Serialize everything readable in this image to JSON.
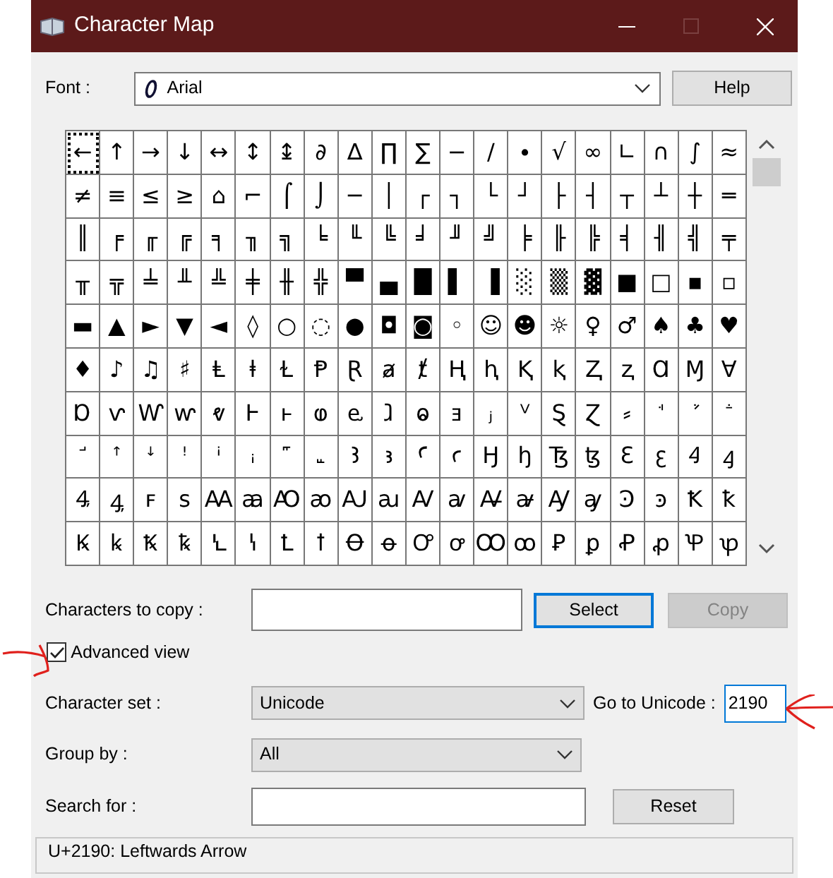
{
  "window": {
    "title": "Character Map",
    "maximize_disabled": true
  },
  "font": {
    "label": "Font :",
    "value": "Arial"
  },
  "help_button": {
    "label": "Help"
  },
  "grid": {
    "rows": [
      {
        "cells": [
          {
            "char": "←",
            "selected": true
          },
          {
            "char": "↑",
            "selected": false
          },
          {
            "char": "→",
            "selected": false
          },
          {
            "char": "↓",
            "selected": false
          },
          {
            "char": "↔",
            "selected": false
          },
          {
            "char": "↕",
            "selected": false
          },
          {
            "char": "↨",
            "selected": false
          },
          {
            "char": "∂",
            "selected": false
          },
          {
            "char": "∆",
            "selected": false
          },
          {
            "char": "∏",
            "selected": false
          },
          {
            "char": "∑",
            "selected": false
          },
          {
            "char": "−",
            "selected": false
          },
          {
            "char": "∕",
            "selected": false
          },
          {
            "char": "∙",
            "selected": false
          },
          {
            "char": "√",
            "selected": false
          },
          {
            "char": "∞",
            "selected": false
          },
          {
            "char": "∟",
            "selected": false
          },
          {
            "char": "∩",
            "selected": false
          },
          {
            "char": "∫",
            "selected": false
          },
          {
            "char": "≈",
            "selected": false
          }
        ]
      },
      {
        "cells": [
          {
            "char": "≠",
            "selected": false
          },
          {
            "char": "≡",
            "selected": false
          },
          {
            "char": "≤",
            "selected": false
          },
          {
            "char": "≥",
            "selected": false
          },
          {
            "char": "⌂",
            "selected": false
          },
          {
            "char": "⌐",
            "selected": false
          },
          {
            "char": "⌠",
            "selected": false
          },
          {
            "char": "⌡",
            "selected": false
          },
          {
            "char": "─",
            "selected": false
          },
          {
            "char": "│",
            "selected": false
          },
          {
            "char": "┌",
            "selected": false
          },
          {
            "char": "┐",
            "selected": false
          },
          {
            "char": "└",
            "selected": false
          },
          {
            "char": "┘",
            "selected": false
          },
          {
            "char": "├",
            "selected": false
          },
          {
            "char": "┤",
            "selected": false
          },
          {
            "char": "┬",
            "selected": false
          },
          {
            "char": "┴",
            "selected": false
          },
          {
            "char": "┼",
            "selected": false
          },
          {
            "char": "═",
            "selected": false
          }
        ]
      },
      {
        "cells": [
          {
            "char": "║",
            "selected": false
          },
          {
            "char": "╒",
            "selected": false
          },
          {
            "char": "╓",
            "selected": false
          },
          {
            "char": "╔",
            "selected": false
          },
          {
            "char": "╕",
            "selected": false
          },
          {
            "char": "╖",
            "selected": false
          },
          {
            "char": "╗",
            "selected": false
          },
          {
            "char": "╘",
            "selected": false
          },
          {
            "char": "╙",
            "selected": false
          },
          {
            "char": "╚",
            "selected": false
          },
          {
            "char": "╛",
            "selected": false
          },
          {
            "char": "╜",
            "selected": false
          },
          {
            "char": "╝",
            "selected": false
          },
          {
            "char": "╞",
            "selected": false
          },
          {
            "char": "╟",
            "selected": false
          },
          {
            "char": "╠",
            "selected": false
          },
          {
            "char": "╡",
            "selected": false
          },
          {
            "char": "╢",
            "selected": false
          },
          {
            "char": "╣",
            "selected": false
          },
          {
            "char": "╤",
            "selected": false
          }
        ]
      },
      {
        "cells": [
          {
            "char": "╥",
            "selected": false
          },
          {
            "char": "╦",
            "selected": false
          },
          {
            "char": "╧",
            "selected": false
          },
          {
            "char": "╨",
            "selected": false
          },
          {
            "char": "╩",
            "selected": false
          },
          {
            "char": "╪",
            "selected": false
          },
          {
            "char": "╫",
            "selected": false
          },
          {
            "char": "╬",
            "selected": false
          },
          {
            "char": "▀",
            "selected": false
          },
          {
            "char": "▄",
            "selected": false
          },
          {
            "char": "█",
            "selected": false
          },
          {
            "char": "▌",
            "selected": false
          },
          {
            "char": "▐",
            "selected": false
          },
          {
            "char": "░",
            "selected": false
          },
          {
            "char": "▒",
            "selected": false
          },
          {
            "char": "▓",
            "selected": false
          },
          {
            "char": "■",
            "selected": false
          },
          {
            "char": "□",
            "selected": false
          },
          {
            "char": "▪",
            "selected": false
          },
          {
            "char": "▫",
            "selected": false
          }
        ]
      },
      {
        "cells": [
          {
            "char": "▬",
            "selected": false
          },
          {
            "char": "▲",
            "selected": false
          },
          {
            "char": "►",
            "selected": false
          },
          {
            "char": "▼",
            "selected": false
          },
          {
            "char": "◄",
            "selected": false
          },
          {
            "char": "◊",
            "selected": false
          },
          {
            "char": "○",
            "selected": false
          },
          {
            "char": "◌",
            "selected": false
          },
          {
            "char": "●",
            "selected": false
          },
          {
            "char": "◘",
            "selected": false
          },
          {
            "char": "◙",
            "selected": false
          },
          {
            "char": "◦",
            "selected": false
          },
          {
            "char": "☺",
            "selected": false
          },
          {
            "char": "☻",
            "selected": false
          },
          {
            "char": "☼",
            "selected": false
          },
          {
            "char": "♀",
            "selected": false
          },
          {
            "char": "♂",
            "selected": false
          },
          {
            "char": "♠",
            "selected": false
          },
          {
            "char": "♣",
            "selected": false
          },
          {
            "char": "♥",
            "selected": false
          }
        ]
      },
      {
        "cells": [
          {
            "char": "♦",
            "selected": false
          },
          {
            "char": "♪",
            "selected": false
          },
          {
            "char": "♫",
            "selected": false
          },
          {
            "char": "♯",
            "selected": false
          },
          {
            "char": "Ⱡ",
            "selected": false
          },
          {
            "char": "ⱡ",
            "selected": false
          },
          {
            "char": "Ɫ",
            "selected": false
          },
          {
            "char": "Ᵽ",
            "selected": false
          },
          {
            "char": "Ɽ",
            "selected": false
          },
          {
            "char": "ⱥ",
            "selected": false
          },
          {
            "char": "ⱦ",
            "selected": false
          },
          {
            "char": "Ⱨ",
            "selected": false
          },
          {
            "char": "ⱨ",
            "selected": false
          },
          {
            "char": "Ⱪ",
            "selected": false
          },
          {
            "char": "ⱪ",
            "selected": false
          },
          {
            "char": "Ⱬ",
            "selected": false
          },
          {
            "char": "ⱬ",
            "selected": false
          },
          {
            "char": "Ɑ",
            "selected": false
          },
          {
            "char": "Ɱ",
            "selected": false
          },
          {
            "char": "Ɐ",
            "selected": false
          }
        ]
      },
      {
        "cells": [
          {
            "char": "Ɒ",
            "selected": false
          },
          {
            "char": "ⱱ",
            "selected": false
          },
          {
            "char": "Ⱳ",
            "selected": false
          },
          {
            "char": "ⱳ",
            "selected": false
          },
          {
            "char": "ⱴ",
            "selected": false
          },
          {
            "char": "Ⱶ",
            "selected": false
          },
          {
            "char": "ⱶ",
            "selected": false
          },
          {
            "char": "ⱷ",
            "selected": false
          },
          {
            "char": "ⱸ",
            "selected": false
          },
          {
            "char": "ⱹ",
            "selected": false
          },
          {
            "char": "ⱺ",
            "selected": false
          },
          {
            "char": "ⱻ",
            "selected": false
          },
          {
            "char": "ⱼ",
            "selected": false
          },
          {
            "char": "ⱽ",
            "selected": false
          },
          {
            "char": "Ȿ",
            "selected": false
          },
          {
            "char": "Ɀ",
            "selected": false
          },
          {
            "char": "⸗",
            "selected": false
          },
          {
            "char": "ꜗ",
            "selected": false
          },
          {
            "char": "ꜘ",
            "selected": false
          },
          {
            "char": "ꜙ",
            "selected": false
          }
        ]
      },
      {
        "cells": [
          {
            "char": "ꜚ",
            "selected": false
          },
          {
            "char": "ꜛ",
            "selected": false
          },
          {
            "char": "ꜜ",
            "selected": false
          },
          {
            "char": "ꜝ",
            "selected": false
          },
          {
            "char": "ꜞ",
            "selected": false
          },
          {
            "char": "ꜟ",
            "selected": false
          },
          {
            "char": "꜠",
            "selected": false
          },
          {
            "char": "꜡",
            "selected": false
          },
          {
            "char": "Ꜣ",
            "selected": false
          },
          {
            "char": "ꜣ",
            "selected": false
          },
          {
            "char": "Ꜥ",
            "selected": false
          },
          {
            "char": "ꜥ",
            "selected": false
          },
          {
            "char": "Ꜧ",
            "selected": false
          },
          {
            "char": "ꜧ",
            "selected": false
          },
          {
            "char": "Ꜩ",
            "selected": false
          },
          {
            "char": "ꜩ",
            "selected": false
          },
          {
            "char": "Ꜫ",
            "selected": false
          },
          {
            "char": "ꜫ",
            "selected": false
          },
          {
            "char": "Ꜭ",
            "selected": false
          },
          {
            "char": "ꜭ",
            "selected": false
          }
        ]
      },
      {
        "cells": [
          {
            "char": "Ꜯ",
            "selected": false
          },
          {
            "char": "ꜯ",
            "selected": false
          },
          {
            "char": "ꜰ",
            "selected": false
          },
          {
            "char": "ꜱ",
            "selected": false
          },
          {
            "char": "Ꜳ",
            "selected": false
          },
          {
            "char": "ꜳ",
            "selected": false
          },
          {
            "char": "Ꜵ",
            "selected": false
          },
          {
            "char": "ꜵ",
            "selected": false
          },
          {
            "char": "Ꜷ",
            "selected": false
          },
          {
            "char": "ꜷ",
            "selected": false
          },
          {
            "char": "Ꜹ",
            "selected": false
          },
          {
            "char": "ꜹ",
            "selected": false
          },
          {
            "char": "Ꜻ",
            "selected": false
          },
          {
            "char": "ꜻ",
            "selected": false
          },
          {
            "char": "Ꜽ",
            "selected": false
          },
          {
            "char": "ꜽ",
            "selected": false
          },
          {
            "char": "Ꜿ",
            "selected": false
          },
          {
            "char": "ꜿ",
            "selected": false
          },
          {
            "char": "Ꝁ",
            "selected": false
          },
          {
            "char": "ꝁ",
            "selected": false
          }
        ]
      },
      {
        "cells": [
          {
            "char": "Ꝃ",
            "selected": false
          },
          {
            "char": "ꝃ",
            "selected": false
          },
          {
            "char": "Ꝅ",
            "selected": false
          },
          {
            "char": "ꝅ",
            "selected": false
          },
          {
            "char": "Ꝇ",
            "selected": false
          },
          {
            "char": "ꝇ",
            "selected": false
          },
          {
            "char": "Ꝉ",
            "selected": false
          },
          {
            "char": "ꝉ",
            "selected": false
          },
          {
            "char": "Ꝋ",
            "selected": false
          },
          {
            "char": "ꝋ",
            "selected": false
          },
          {
            "char": "Ꝍ",
            "selected": false
          },
          {
            "char": "ꝍ",
            "selected": false
          },
          {
            "char": "Ꝏ",
            "selected": false
          },
          {
            "char": "ꝏ",
            "selected": false
          },
          {
            "char": "Ꝑ",
            "selected": false
          },
          {
            "char": "ꝑ",
            "selected": false
          },
          {
            "char": "Ꝓ",
            "selected": false
          },
          {
            "char": "ꝓ",
            "selected": false
          },
          {
            "char": "Ꝕ",
            "selected": false
          },
          {
            "char": "ꝕ",
            "selected": false
          }
        ]
      }
    ]
  },
  "characters_to_copy": {
    "label": "Characters to copy :"
  },
  "select_button": {
    "label": "Select",
    "focused": true
  },
  "copy_button": {
    "label": "Copy",
    "disabled": true
  },
  "advanced_view": {
    "label": "Advanced view",
    "checked": true
  },
  "character_set": {
    "label": "Character set :",
    "value": "Unicode"
  },
  "go_to_unicode": {
    "label": "Go to Unicode :",
    "value": "2190"
  },
  "group_by": {
    "label": "Group by :",
    "value": "All"
  },
  "search_for": {
    "label": "Search for :"
  },
  "reset_button": {
    "label": "Reset"
  },
  "status_bar": "U+2190: Leftwards Arrow"
}
